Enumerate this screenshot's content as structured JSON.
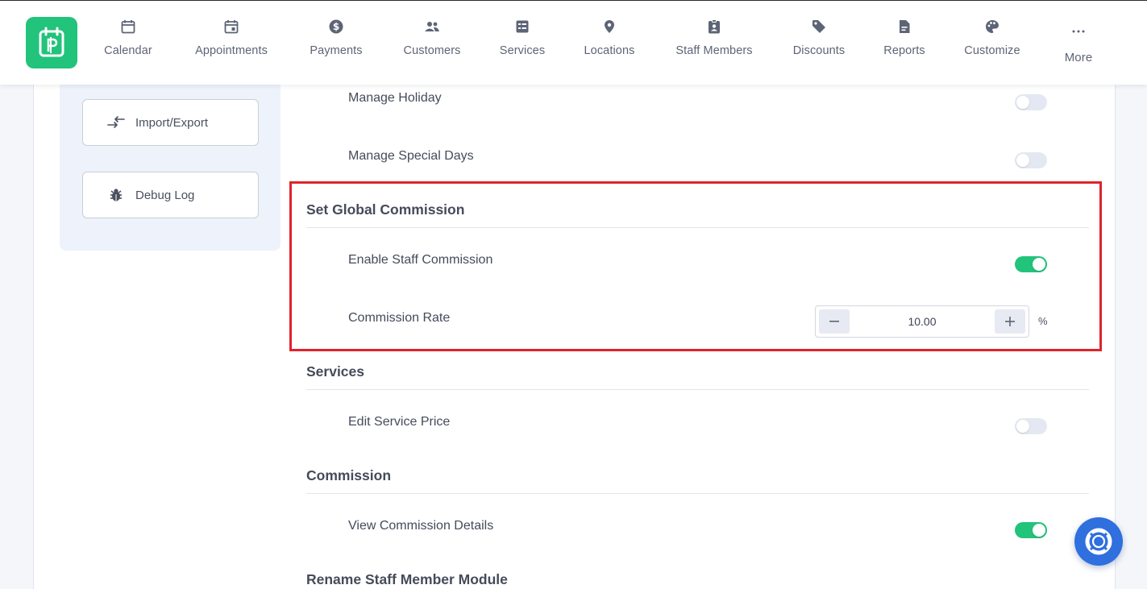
{
  "nav": {
    "items": [
      {
        "label": "Calendar",
        "icon": "calendar-icon"
      },
      {
        "label": "Appointments",
        "icon": "calendar-event-icon"
      },
      {
        "label": "Payments",
        "icon": "dollar-icon"
      },
      {
        "label": "Customers",
        "icon": "users-icon"
      },
      {
        "label": "Services",
        "icon": "list-icon"
      },
      {
        "label": "Locations",
        "icon": "map-pin-icon"
      },
      {
        "label": "Staff Members",
        "icon": "badge-icon"
      },
      {
        "label": "Discounts",
        "icon": "tag-icon"
      },
      {
        "label": "Reports",
        "icon": "report-icon"
      },
      {
        "label": "Customize",
        "icon": "palette-icon"
      },
      {
        "label": "More",
        "icon": "ellipsis-icon"
      }
    ]
  },
  "sidebar": {
    "import_export": "Import/Export",
    "debug_log": "Debug Log"
  },
  "settings": {
    "manage_holiday": {
      "label": "Manage Holiday",
      "enabled": false
    },
    "manage_special_days": {
      "label": "Manage Special Days",
      "enabled": false
    },
    "global_commission": {
      "title": "Set Global Commission",
      "enable_staff_commission": {
        "label": "Enable Staff Commission",
        "enabled": true
      },
      "commission_rate": {
        "label": "Commission Rate",
        "value": "10.00",
        "unit": "%"
      }
    },
    "services": {
      "title": "Services",
      "edit_service_price": {
        "label": "Edit Service Price",
        "enabled": false
      }
    },
    "commission": {
      "title": "Commission",
      "view_commission_details": {
        "label": "View Commission Details",
        "enabled": true
      }
    },
    "rename_staff": {
      "title": "Rename Staff Member Module"
    }
  },
  "colors": {
    "brand": "#22c37b",
    "toggle_off": "#e3e8f2",
    "highlight": "#e0232b",
    "help": "#2f6fde"
  }
}
